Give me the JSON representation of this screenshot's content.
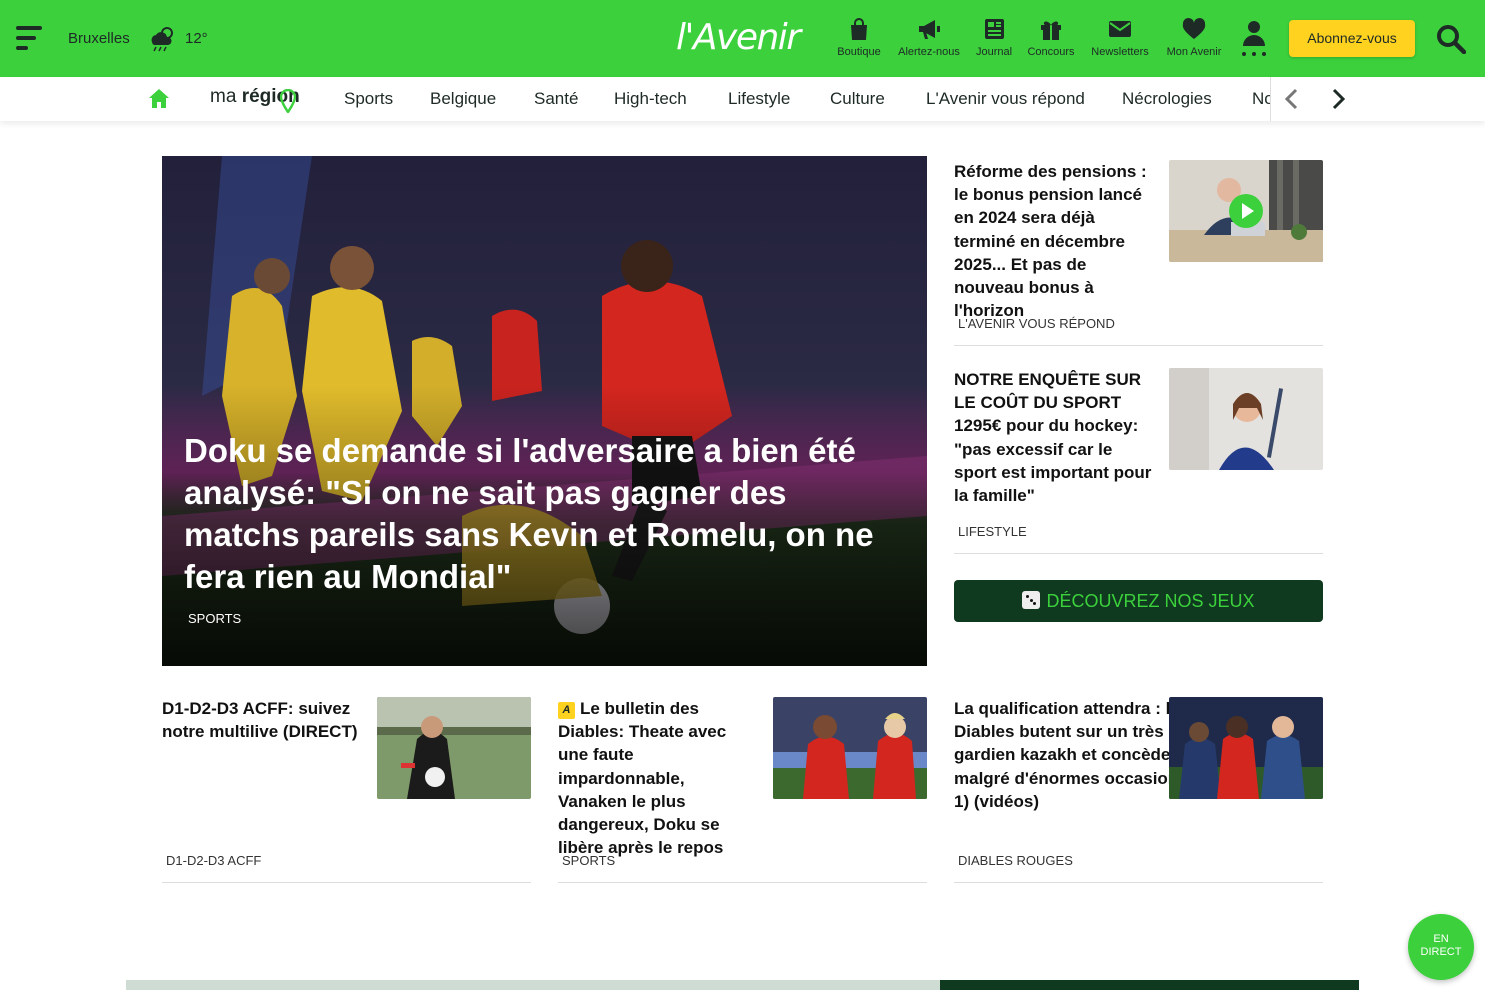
{
  "header": {
    "city": "Bruxelles",
    "temperature": "12°",
    "logo": "l'Avenir",
    "nav_icons": [
      {
        "label": "Boutique",
        "icon": "shopping-bag-icon"
      },
      {
        "label": "Alertez-nous",
        "icon": "megaphone-icon"
      },
      {
        "label": "Journal",
        "icon": "newspaper-icon"
      },
      {
        "label": "Concours",
        "icon": "gift-icon"
      },
      {
        "label": "Newsletters",
        "icon": "envelope-icon"
      },
      {
        "label": "Mon Avenir",
        "icon": "heart-icon"
      }
    ],
    "subscribe_label": "Abonnez-vous"
  },
  "secnav": {
    "ma_region_prefix": "ma ",
    "ma_region_bold": "région",
    "items": [
      "Sports",
      "Belgique",
      "Santé",
      "High-tech",
      "Lifestyle",
      "Culture",
      "L'Avenir vous répond",
      "Nécrologies",
      "No"
    ]
  },
  "hero": {
    "title": "Doku se demande si l'adversaire a bien été analysé: \"Si on ne sait pas gagner des matchs pareils sans Kevin et Romelu, on ne fera rien au Mondial\"",
    "category": "SPORTS"
  },
  "side_articles": [
    {
      "title": "Réforme des pensions : le bonus pension lancé en 2024 sera déjà terminé en décembre 2025... Et pas de nouveau bonus à l'horizon",
      "category": "L'AVENIR VOUS RÉPOND"
    },
    {
      "title": "NOTRE ENQUÊTE SUR LE COÛT DU SPORT 1295€ pour du hockey: \"pas excessif car le sport est important pour la famille\"",
      "category": "LIFESTYLE"
    }
  ],
  "games_button": "DÉCOUVREZ NOS JEUX",
  "cards": [
    {
      "title": "D1-D2-D3 ACFF: suivez notre multilive (DIRECT)",
      "category": "D1-D2-D3 ACFF"
    },
    {
      "badge": "A",
      "title": "Le bulletin des Diables: Theate avec une faute impardonnable, Vanaken le plus dangereux, Doku se libère après le repos",
      "category": "SPORTS"
    },
    {
      "title": "La qualification attendra : les Diables butent sur un très grand gardien kazakh et concède le nul malgré d'énormes occasions (1-1) (vidéos)",
      "category": "DIABLES ROUGES"
    }
  ],
  "live_button": {
    "line1": "EN",
    "line2": "DIRECT"
  },
  "colors": {
    "brand_green": "#3cd13c",
    "dark_green": "#0f3a1f",
    "subscribe_yellow": "#ffd21f",
    "text_dark": "#1e2a26"
  }
}
